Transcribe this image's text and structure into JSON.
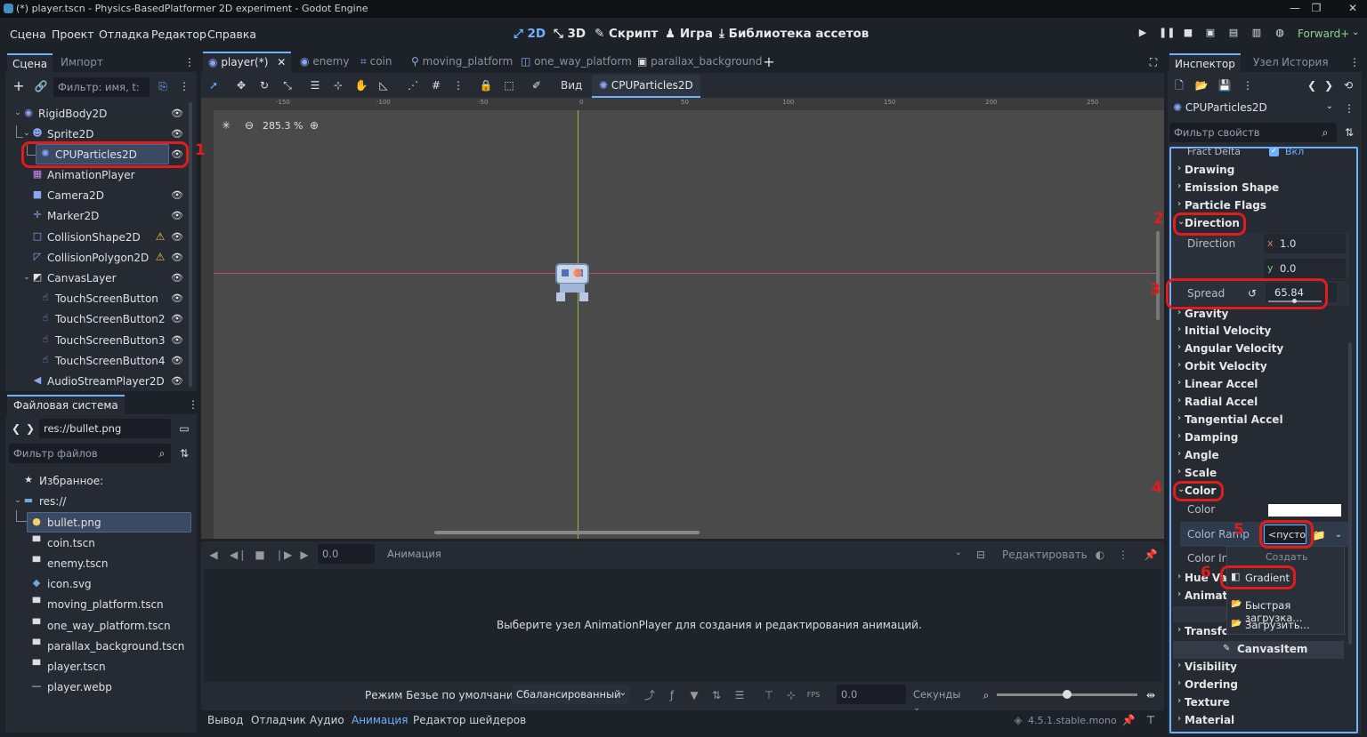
{
  "window": {
    "title": "(*) player.tscn - Physics-BasedPlatformer 2D experiment - Godot Engine"
  },
  "menu": [
    "Сцена",
    "Проект",
    "Отладка",
    "Редактор",
    "Справка"
  ],
  "modes": {
    "m2d": "2D",
    "m3d": "3D",
    "script": "Скрипт",
    "game": "Игра",
    "assetlib": "Библиотека ассетов"
  },
  "renderer": "Forward+",
  "scene_dock": {
    "tabs": [
      "Сцена",
      "Импорт"
    ],
    "filter_placeholder": "Фильтр: имя, t:",
    "nodes": [
      {
        "label": "RigidBody2D",
        "icon": "rigidbody-icon",
        "glyph": "◉",
        "color": "#8da5f3"
      },
      {
        "label": "Sprite2D",
        "icon": "sprite-icon",
        "glyph": "☻",
        "color": "#8da5f3"
      },
      {
        "label": "CPUParticles2D",
        "icon": "particles-icon",
        "glyph": "✺",
        "color": "#8da5f3"
      },
      {
        "label": "AnimationPlayer",
        "icon": "animation-player-icon",
        "glyph": "▦",
        "color": "#c38ef1"
      },
      {
        "label": "Camera2D",
        "icon": "camera-icon",
        "glyph": "■",
        "color": "#8da5f3"
      },
      {
        "label": "Marker2D",
        "icon": "marker-icon",
        "glyph": "✛",
        "color": "#8da5f3"
      },
      {
        "label": "CollisionShape2D",
        "icon": "collision-shape-icon",
        "glyph": "□",
        "color": "#8da5f3"
      },
      {
        "label": "CollisionPolygon2D",
        "icon": "collision-polygon-icon",
        "glyph": "◸",
        "color": "#8da5f3"
      },
      {
        "label": "CanvasLayer",
        "icon": "canvas-layer-icon",
        "glyph": "◩",
        "color": "#e0e0e0"
      },
      {
        "label": "TouchScreenButton",
        "icon": "touch-button-icon",
        "glyph": "☝",
        "color": "#8da5f3"
      },
      {
        "label": "TouchScreenButton2",
        "icon": "touch-button-icon",
        "glyph": "☝",
        "color": "#8da5f3"
      },
      {
        "label": "TouchScreenButton3",
        "icon": "touch-button-icon",
        "glyph": "☝",
        "color": "#8da5f3"
      },
      {
        "label": "TouchScreenButton4",
        "icon": "touch-button-icon",
        "glyph": "☝",
        "color": "#8da5f3"
      },
      {
        "label": "AudioStreamPlayer2D",
        "icon": "audio-player-icon",
        "glyph": "🔊",
        "color": "#8da5f3"
      }
    ]
  },
  "filesystem": {
    "title": "Файловая система",
    "path": "res://bullet.png",
    "filter_placeholder": "Фильтр файлов",
    "favorites": "Избранное:",
    "root": "res://",
    "files": [
      "bullet.png",
      "coin.tscn",
      "enemy.tscn",
      "icon.svg",
      "moving_platform.tscn",
      "one_way_platform.tscn",
      "parallax_background.tscn",
      "player.tscn",
      "player.webp"
    ]
  },
  "editor_tabs": [
    "player(*)",
    "enemy",
    "coin",
    "moving_platform",
    "one_way_platform",
    "parallax_background"
  ],
  "toolbar": {
    "view": "Вид",
    "node": "CPUParticles2D"
  },
  "viewport": {
    "zoom": "285.3 %",
    "ruler": [
      "-150",
      "-100",
      "-50",
      "0",
      "50",
      "100",
      "150",
      "200",
      "250"
    ]
  },
  "animation": {
    "time": "0.0",
    "name_placeholder": "Анимация",
    "edit": "Редактировать",
    "message": "Выберите узел AnimationPlayer для создания и редактирования анимаций.",
    "bezier_label": "Режим Безье по умолчанию:",
    "bezier_mode": "Сбалансированный",
    "fps_value": "0.0",
    "units": "Секунды"
  },
  "bottom_tabs": [
    "Вывод",
    "Отладчик",
    "Аудио",
    "Анимация",
    "Редактор шейдеров"
  ],
  "version": "4.5.1.stable.mono",
  "inspector": {
    "tabs": [
      "Инспектор",
      "Узел",
      "История"
    ],
    "node": "CPUParticles2D",
    "filter_placeholder": "Фильтр свойств",
    "fract_delta": "Fract Delta",
    "fract_value": "Вкл",
    "sections_a": [
      "Drawing",
      "Emission Shape",
      "Particle Flags"
    ],
    "direction": {
      "label": "Direction",
      "x": "1.0",
      "y": "0.0",
      "spread_label": "Spread",
      "spread": "65.84"
    },
    "sections_b": [
      "Gravity",
      "Initial Velocity",
      "Angular Velocity",
      "Orbit Velocity",
      "Linear Accel",
      "Radial Accel",
      "Tangential Accel",
      "Damping",
      "Angle",
      "Scale"
    ],
    "color": {
      "section": "Color",
      "color_label": "Color",
      "ramp_label": "Color Ramp",
      "ramp_value": "<пусто",
      "color_in": "Color In",
      "hue": "Hue Va",
      "anim": "Animati",
      "transform": "Transfor"
    },
    "popup": {
      "create": "Создать",
      "gradient": "Gradient",
      "quick_load": "Быстрая загрузка...",
      "load": "Загрузить..."
    },
    "canvas_item": "CanvasItem",
    "sections_c": [
      "Visibility",
      "Ordering",
      "Texture",
      "Material"
    ]
  },
  "annotations": [
    "1",
    "2",
    "3",
    "4",
    "5",
    "6"
  ]
}
